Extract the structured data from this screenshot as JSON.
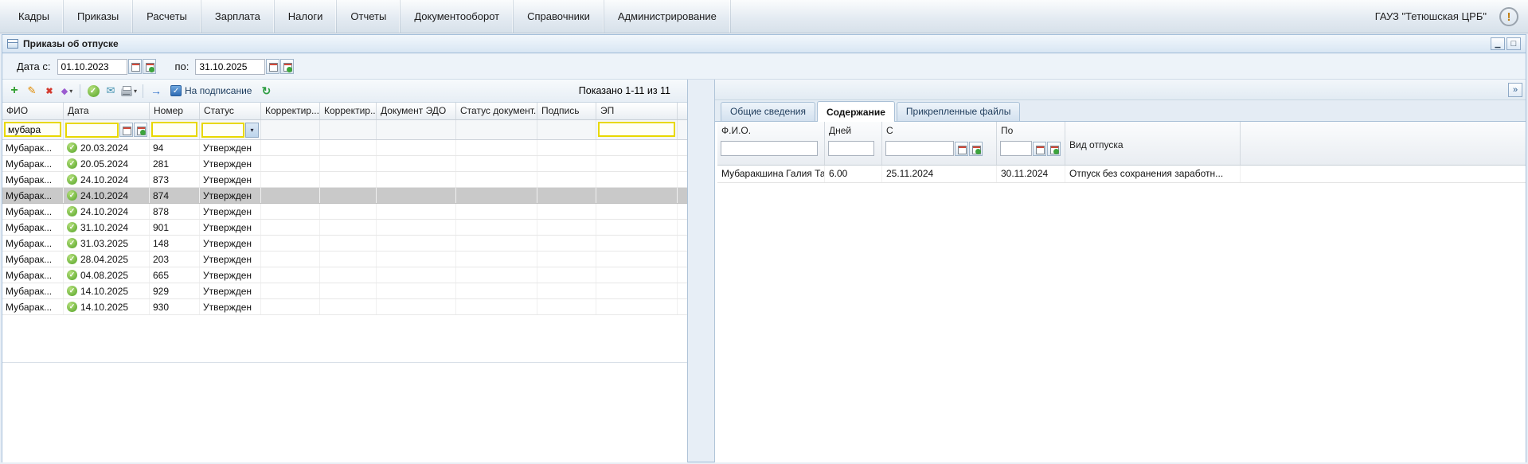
{
  "menubar": {
    "items": [
      "Кадры",
      "Приказы",
      "Расчеты",
      "Зарплата",
      "Налоги",
      "Отчеты",
      "Документооборот",
      "Справочники",
      "Администрирование"
    ],
    "org": "ГАУЗ \"Тетюшская ЦРБ\""
  },
  "window": {
    "title": "Приказы об отпуске"
  },
  "filterbar": {
    "date_from_label": "Дата с:",
    "date_from": "01.10.2023",
    "date_to_label": "по:",
    "date_to": "31.10.2025"
  },
  "toolbar": {
    "sign_label": "На подписание",
    "status": "Показано 1-11 из 11"
  },
  "orders_grid": {
    "columns": [
      "ФИО",
      "Дата",
      "Номер",
      "Статус",
      "Корректир...",
      "Корректир...",
      "Документ ЭДО",
      "Статус документ...",
      "Подпись",
      "ЭП"
    ],
    "filters": {
      "fio": "мубара"
    },
    "rows": [
      {
        "fio": "Мубарак...",
        "date": "20.03.2024",
        "number": "94",
        "status": "Утвержден",
        "selected": false
      },
      {
        "fio": "Мубарак...",
        "date": "20.05.2024",
        "number": "281",
        "status": "Утвержден",
        "selected": false
      },
      {
        "fio": "Мубарак...",
        "date": "24.10.2024",
        "number": "873",
        "status": "Утвержден",
        "selected": false
      },
      {
        "fio": "Мубарак...",
        "date": "24.10.2024",
        "number": "874",
        "status": "Утвержден",
        "selected": true
      },
      {
        "fio": "Мубарак...",
        "date": "24.10.2024",
        "number": "878",
        "status": "Утвержден",
        "selected": false
      },
      {
        "fio": "Мубарак...",
        "date": "31.10.2024",
        "number": "901",
        "status": "Утвержден",
        "selected": false
      },
      {
        "fio": "Мубарак...",
        "date": "31.03.2025",
        "number": "148",
        "status": "Утвержден",
        "selected": false
      },
      {
        "fio": "Мубарак...",
        "date": "28.04.2025",
        "number": "203",
        "status": "Утвержден",
        "selected": false
      },
      {
        "fio": "Мубарак...",
        "date": "04.08.2025",
        "number": "665",
        "status": "Утвержден",
        "selected": false
      },
      {
        "fio": "Мубарак...",
        "date": "14.10.2025",
        "number": "929",
        "status": "Утвержден",
        "selected": false
      },
      {
        "fio": "Мубарак...",
        "date": "14.10.2025",
        "number": "930",
        "status": "Утвержден",
        "selected": false
      }
    ]
  },
  "detail_panel": {
    "tabs": [
      "Общие сведения",
      "Содержание",
      "Прикрепленные файлы"
    ],
    "active_tab": "Содержание",
    "content_grid": {
      "columns": [
        "Ф.И.О.",
        "Дней",
        "С",
        "По",
        "Вид отпуска"
      ],
      "rows": [
        {
          "fio": "Мубаракшина Галия Тау...",
          "days": "6.00",
          "from": "25.11.2024",
          "to": "30.11.2024",
          "type": "Отпуск без сохранения заработн..."
        }
      ]
    }
  },
  "colors": {
    "filter_highlight": "#e8d800",
    "selected_row": "#c9c9c9",
    "approved_green": "#54a326",
    "accent_blue": "#2f6cb3"
  }
}
